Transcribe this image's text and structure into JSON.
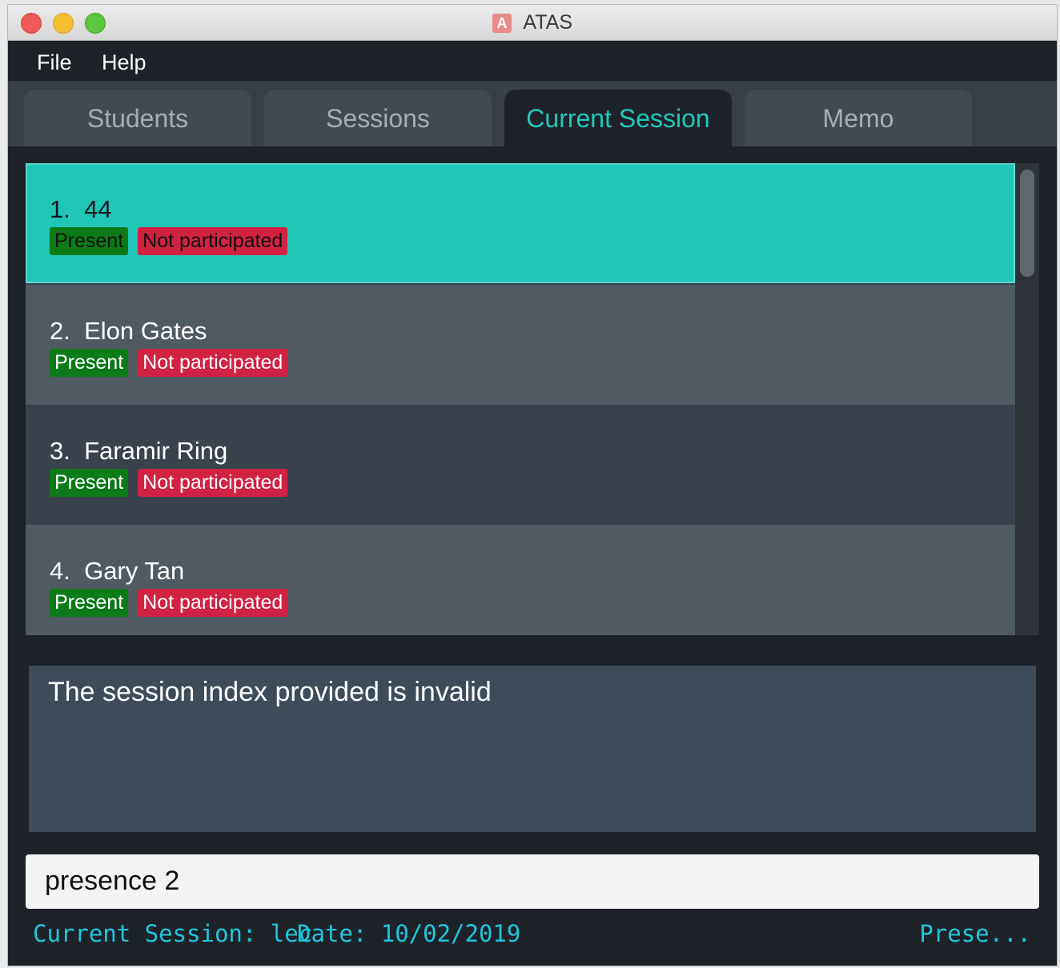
{
  "window": {
    "title": "ATAS",
    "app_icon_letter": "A"
  },
  "menu": {
    "items": [
      "File",
      "Help"
    ]
  },
  "tabs": [
    {
      "label": "Students"
    },
    {
      "label": "Sessions"
    },
    {
      "label": "Current Session"
    },
    {
      "label": "Memo"
    }
  ],
  "active_tab": "Current Session",
  "attendance_list": [
    {
      "label": "1.  44",
      "presence": "Present",
      "participation": "Not participated",
      "selected": true
    },
    {
      "label": "2.  Elon Gates",
      "presence": "Present",
      "participation": "Not participated"
    },
    {
      "label": "3.  Faramir Ring",
      "presence": "Present",
      "participation": "Not participated"
    },
    {
      "label": "4.  Gary Tan",
      "presence": "Present",
      "participation": "Not participated"
    }
  ],
  "result_display": {
    "message": "The session index provided is invalid"
  },
  "command_box": {
    "value": "presence 2"
  },
  "status_bar": {
    "session": "Current Session: lec",
    "date": "Date: 10/02/2019",
    "right": "Prese..."
  },
  "colors": {
    "accent": "#1fc8ba",
    "present": "#0c7b17",
    "not_participated": "#d22242",
    "status_text": "#1ec6dc"
  }
}
